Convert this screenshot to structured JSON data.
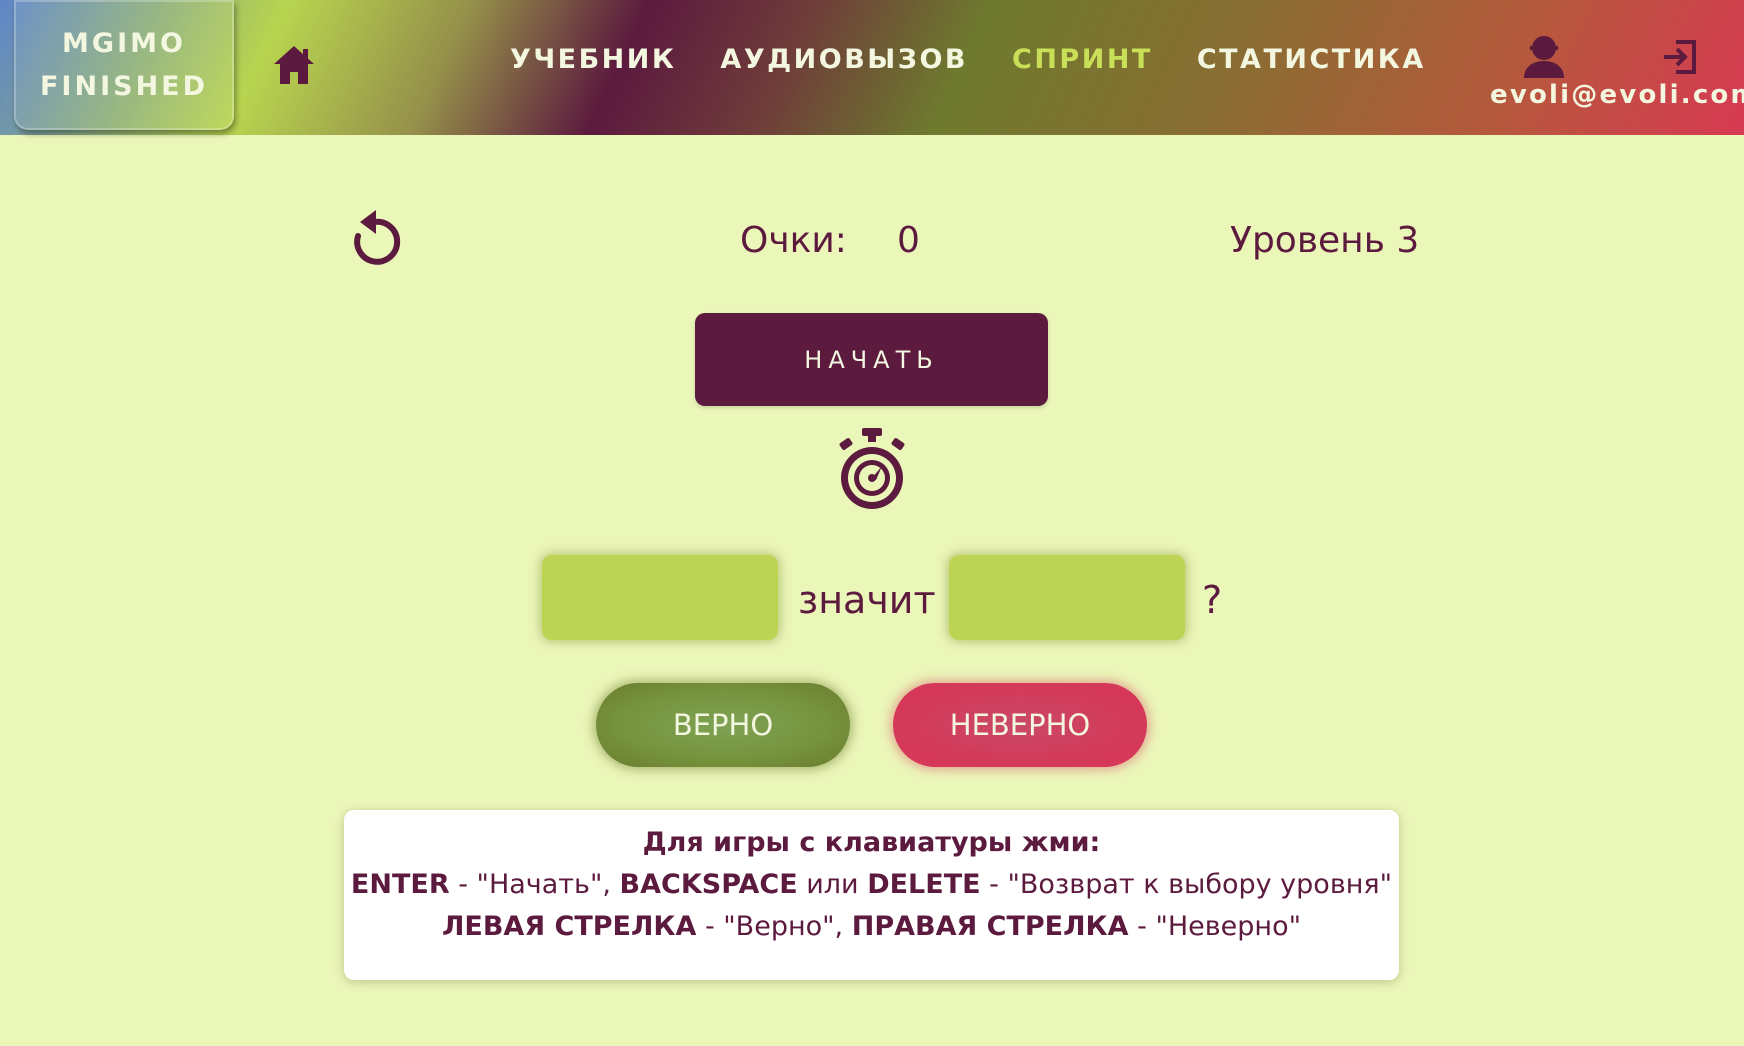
{
  "header": {
    "logo_line1": "MGIMO",
    "logo_line2": "FINISHED",
    "nav": [
      {
        "label": "УЧЕБНИК",
        "active": false
      },
      {
        "label": "АУДИОВЫЗОВ",
        "active": false
      },
      {
        "label": "СПРИНТ",
        "active": true
      },
      {
        "label": "СТАТИСТИКА",
        "active": false
      }
    ],
    "user_email": "evoli@evoli.com",
    "icons": {
      "home": "home-icon",
      "user": "user-icon",
      "logout": "logout-icon"
    }
  },
  "game": {
    "score_label": "Очки:",
    "score_value": "0",
    "level_label": "Уровень 3",
    "start_label": "НАЧАТЬ",
    "means_label": "значит",
    "question_mark": "?",
    "correct_label": "ВЕРНО",
    "wrong_label": "НЕВЕРНО",
    "word_left": "",
    "word_right": ""
  },
  "help": {
    "title": "Для игры с клавиатуры жми:",
    "line1": {
      "key1": "ENTER",
      "text1": " - \"Начать\", ",
      "key2": "BACKSPACE",
      "text2": " или ",
      "key3": "DELETE",
      "text3": " - \"Возврат к выбору уровня\""
    },
    "line2": {
      "key1": "ЛЕВАЯ СТРЕЛКА",
      "text1": " - \"Верно\", ",
      "key2": "ПРАВАЯ СТРЕЛКА",
      "text2": " - \"Неверно\""
    }
  },
  "colors": {
    "background": "#ebf6b9",
    "primary": "#5c1a3e",
    "accent_active": "#c8df57",
    "word_box": "#bcd354",
    "correct": "#76943e",
    "wrong": "#d8365a"
  }
}
